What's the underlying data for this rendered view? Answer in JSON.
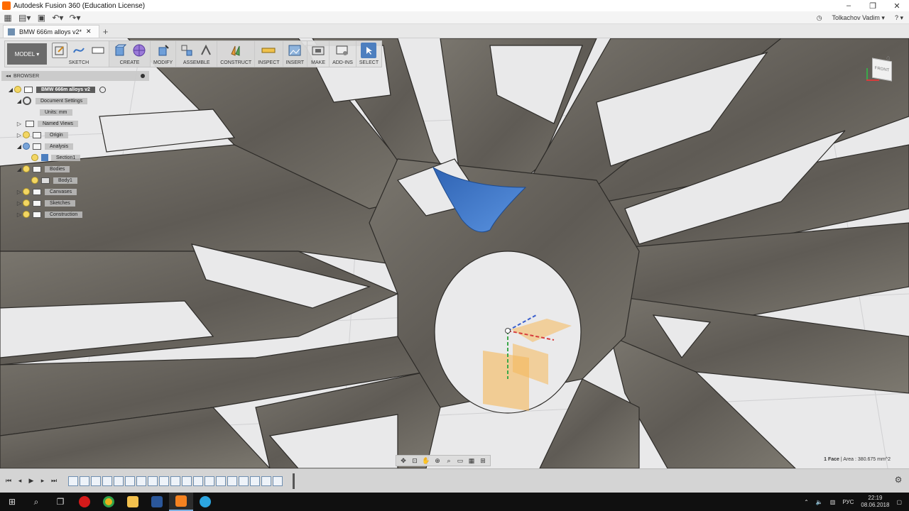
{
  "window": {
    "title": "Autodesk Fusion 360 (Education License)",
    "controls": [
      "–",
      "❐",
      "✕"
    ]
  },
  "quickbar": {
    "user": "Tolkachov Vadim",
    "help": "?"
  },
  "doc_tab": {
    "label": "BMW 666m alloys v2*",
    "close": "✕",
    "add": "+"
  },
  "ribbon": {
    "workspace": "MODEL",
    "groups": [
      {
        "label": "SKETCH"
      },
      {
        "label": "CREATE"
      },
      {
        "label": "MODIFY"
      },
      {
        "label": "ASSEMBLE"
      },
      {
        "label": "CONSTRUCT"
      },
      {
        "label": "INSPECT"
      },
      {
        "label": "INSERT"
      },
      {
        "label": "MAKE"
      },
      {
        "label": "ADD-INS"
      },
      {
        "label": "SELECT"
      }
    ]
  },
  "browser": {
    "title": "BROWSER",
    "root": "BMW 666m alloys v2",
    "items": [
      {
        "label": "Document Settings"
      },
      {
        "label": "Units: mm"
      },
      {
        "label": "Named Views"
      },
      {
        "label": "Origin"
      },
      {
        "label": "Analysis"
      },
      {
        "label": "Section1"
      },
      {
        "label": "Bodies"
      },
      {
        "label": "Body1"
      },
      {
        "label": "Canvases"
      },
      {
        "label": "Sketches"
      },
      {
        "label": "Construction"
      }
    ]
  },
  "viewcube": {
    "face": "FRONT"
  },
  "status": {
    "label": "1 Face",
    "area": "Area : 380.675 mm^2"
  },
  "taskbar": {
    "lang": "РУС",
    "time": "22:19",
    "date": "08.06.2018"
  },
  "colors": {
    "accent": "#3a74c4",
    "metal": "#6e6a63",
    "viewport_bg": "#e9e9ea",
    "selection_face": "#3b73c4"
  }
}
